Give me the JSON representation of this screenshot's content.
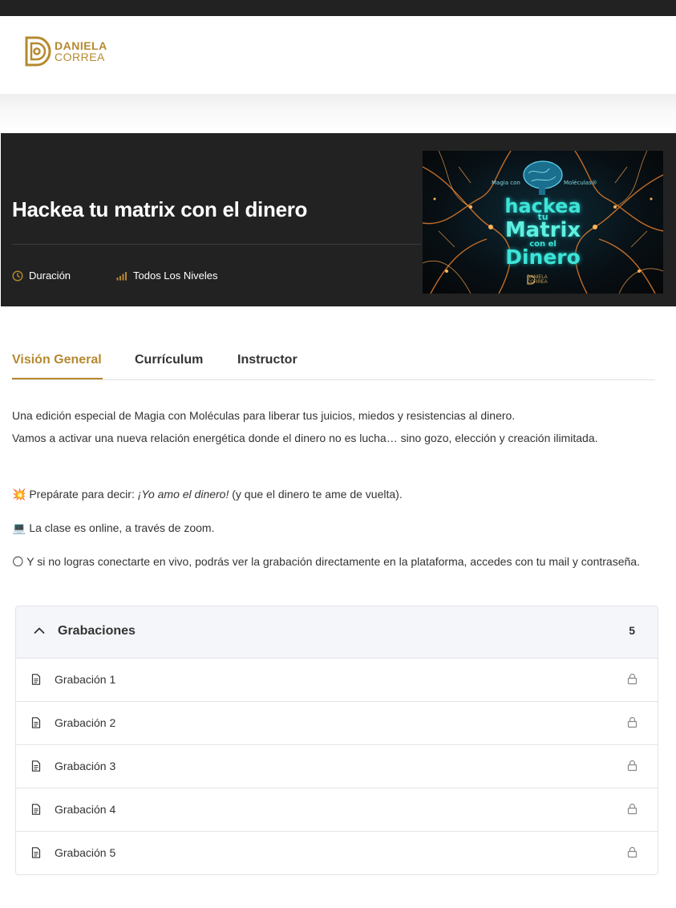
{
  "brand": {
    "line1": "DANIELA",
    "line2": "CORREA",
    "color": "#b5892f"
  },
  "course": {
    "title": "Hackea tu matrix con el dinero",
    "meta": [
      {
        "icon": "clock-icon",
        "label": "Duración"
      },
      {
        "icon": "bar-chart-icon",
        "label": "Todos Los Niveles"
      }
    ],
    "banner": {
      "tag_left": "Magia con",
      "tag_right": "Moléculas®",
      "line1": "hackea",
      "line2": "tu",
      "line3": "Matrix",
      "line4": "con el",
      "line5": "Dinero",
      "brand1": "DANIELA",
      "brand2": "CORREA"
    }
  },
  "tabs": [
    {
      "label": "Visión General",
      "active": true
    },
    {
      "label": "Currículum",
      "active": false
    },
    {
      "label": "Instructor",
      "active": false
    }
  ],
  "description": {
    "p1_line1": "Una edición especial de Magia con Moléculas para liberar tus juicios, miedos y resistencias al dinero.",
    "p1_line2": "Vamos a activar una nueva relación energética donde el dinero no es lucha… sino gozo, elección y creación ilimitada.",
    "p2_emoji": "💥",
    "p2_pre": "Prepárate para decir: ",
    "p2_em": "¡Yo amo el dinero!",
    "p2_post": " (y que el dinero te ame de vuelta).",
    "p3_emoji": "💻",
    "p3_text": "La clase es online, a través de zoom.",
    "p4_emoji": "🌕",
    "p4_text": "Y si no logras conectarte en vivo, podrás ver la grabación directamente en la plataforma, accedes con tu mail y contraseña."
  },
  "curriculum": {
    "section_title": "Grabaciones",
    "count": "5",
    "items": [
      {
        "label": "Grabación 1",
        "locked": true
      },
      {
        "label": "Grabación 2",
        "locked": true
      },
      {
        "label": "Grabación 3",
        "locked": true
      },
      {
        "label": "Grabación 4",
        "locked": true
      },
      {
        "label": "Grabación 5",
        "locked": true
      }
    ]
  },
  "colors": {
    "accent": "#b5892f",
    "hero_bg": "#222222",
    "banner_text": "#3ee4d8"
  }
}
